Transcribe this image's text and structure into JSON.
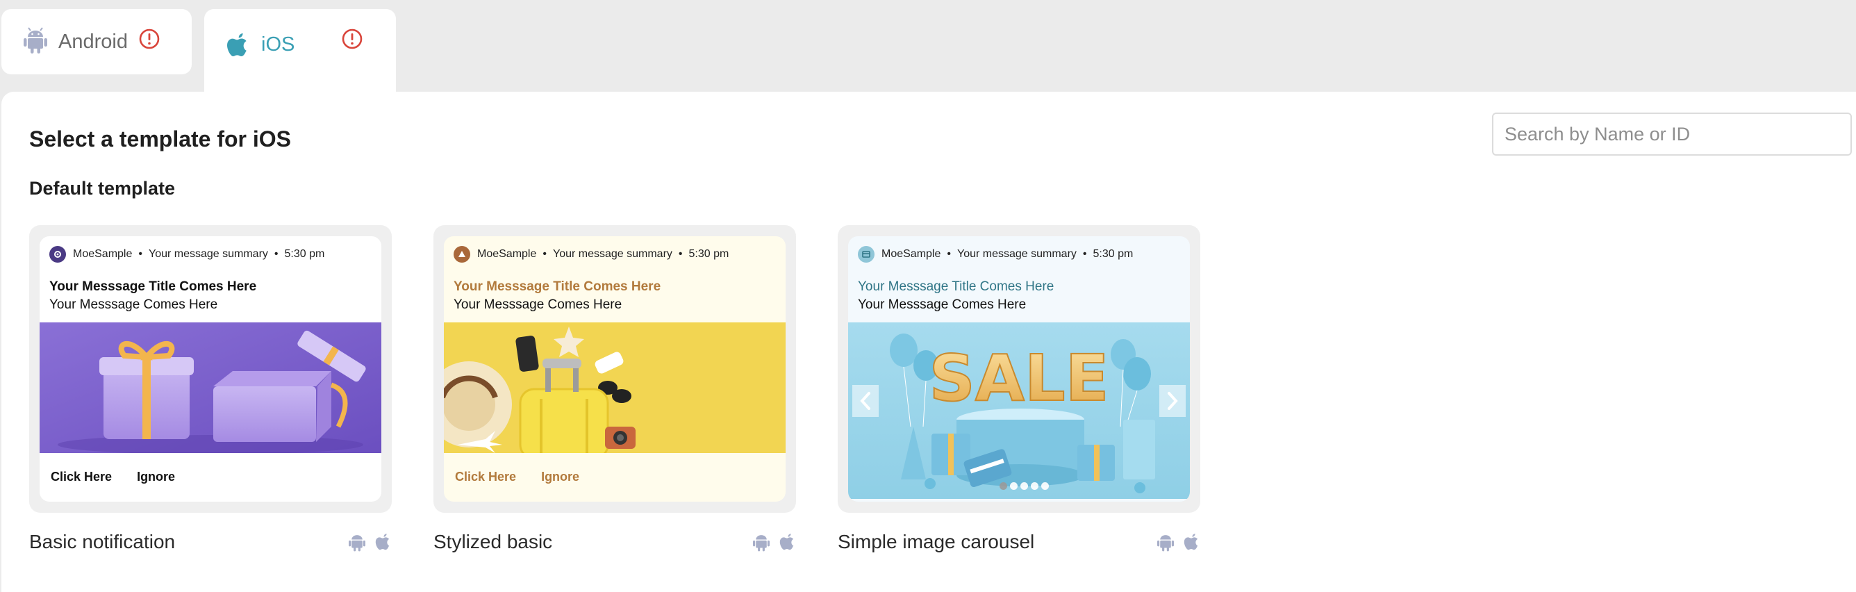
{
  "tabs": [
    {
      "label": "Android",
      "icon": "android-icon",
      "status_icon": "warning-circle-icon"
    },
    {
      "label": "iOS",
      "icon": "apple-icon",
      "status_icon": "warning-circle-icon",
      "selected": true
    }
  ],
  "colors": {
    "accent": "#3a9fb4",
    "warning": "#d9453b",
    "platform_icon": "#a7aec8",
    "styled_text": "#b27a3c",
    "carousel_title": "#2f7586"
  },
  "page": {
    "title": "Select a template for iOS",
    "section": "Default template"
  },
  "search": {
    "placeholder": "Search by Name or ID",
    "value": ""
  },
  "templates": [
    {
      "name": "Basic notification",
      "app_name": "MoeSample",
      "summary": "Your message summary",
      "time": "5:30 pm",
      "title": "Your Messsage Title Comes Here",
      "message": "Your Messsage Comes Here",
      "actions": [
        "Click Here",
        "Ignore"
      ],
      "platforms": [
        "android-icon",
        "apple-icon"
      ]
    },
    {
      "name": "Stylized basic",
      "app_name": "MoeSample",
      "summary": "Your message summary",
      "time": "5:30 pm",
      "title": "Your Messsage Title Comes Here",
      "message": "Your Messsage Comes Here",
      "actions": [
        "Click Here",
        "Ignore"
      ],
      "platforms": [
        "android-icon",
        "apple-icon"
      ]
    },
    {
      "name": "Simple image carousel",
      "app_name": "MoeSample",
      "summary": "Your message summary",
      "time": "5:30 pm",
      "title": "Your Messsage Title Comes Here",
      "message": "Your Messsage Comes Here",
      "image_text": "SALE",
      "carousel_slides": 5,
      "platforms": [
        "android-icon",
        "apple-icon"
      ]
    }
  ]
}
